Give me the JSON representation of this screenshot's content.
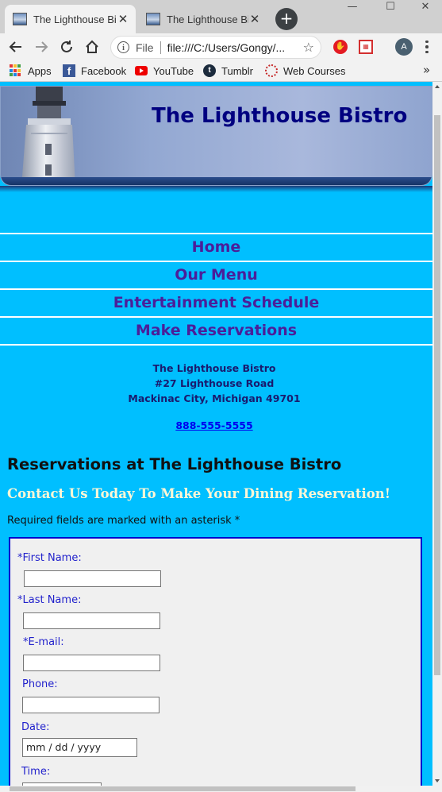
{
  "browser": {
    "tabs": [
      {
        "title": "The Lighthouse Bistro"
      },
      {
        "title": "The Lighthouse Bistro"
      }
    ],
    "new_tab_symbol": "+",
    "address_bar": {
      "scheme": "File",
      "url": "file:///C:/Users/Gongy/..."
    },
    "profile_initial": "A",
    "bookmarks": [
      {
        "label": "Apps",
        "icon": "apps-grid-icon"
      },
      {
        "label": "Facebook",
        "icon": "facebook-icon"
      },
      {
        "label": "YouTube",
        "icon": "youtube-icon"
      },
      {
        "label": "Tumblr",
        "icon": "tumblr-icon"
      },
      {
        "label": "Web Courses",
        "icon": "web-courses-icon"
      }
    ],
    "bookmarks_more": "»",
    "colors": {
      "tab_active": "#f2f2f2",
      "tab_strip": "#d0d0d0"
    }
  },
  "site": {
    "banner_title": "The Lighthouse Bistro",
    "nav": [
      {
        "label": "Home"
      },
      {
        "label": "Our Menu"
      },
      {
        "label": "Entertainment Schedule"
      },
      {
        "label": "Make Reservations"
      }
    ],
    "address": {
      "name": "The Lighthouse Bistro",
      "street": "#27 Lighthouse Road",
      "city": "Mackinac City, Michigan 49701",
      "phone": "888-555-5555"
    },
    "page_heading": "Reservations at The Lighthouse Bistro",
    "subheading": "Contact Us Today To Make Your Dining Reservation!",
    "required_note": "Required fields are marked with an asterisk *",
    "form": {
      "first_name_label": "*First Name:",
      "first_name_value": "",
      "last_name_label": "*Last Name:",
      "last_name_value": "",
      "email_label": "*E-mail:",
      "email_value": "",
      "phone_label": "Phone:",
      "phone_value": "",
      "date_label": "Date:",
      "date_placeholder": "mm / dd / yyyy",
      "time_label": "Time:"
    },
    "colors": {
      "page_background": "#00bfff",
      "nav_text": "#4b1e9a",
      "banner_title": "#000080",
      "form_border": "#0000cd",
      "form_label": "#2222cc",
      "subheading": "#fff7d6"
    }
  }
}
